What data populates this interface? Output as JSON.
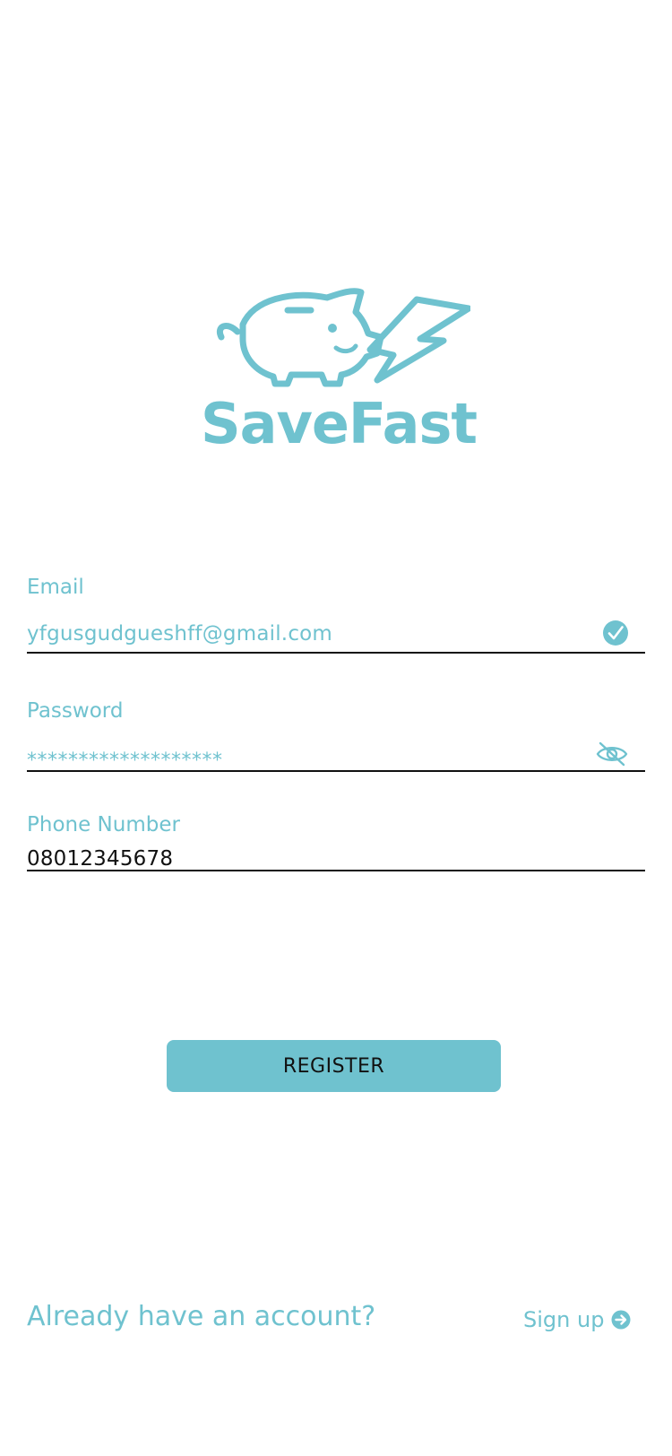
{
  "brand": {
    "name": "SaveFast",
    "logo_icon": "piggy-bank-lightning-icon",
    "color": "#6fc2cf"
  },
  "form": {
    "email": {
      "label": "Email",
      "value": "yfgusgudgueshff@gmail.com",
      "status_icon": "check-circle-icon"
    },
    "password": {
      "label": "Password",
      "value": "*******************",
      "toggle_icon": "eye-off-icon"
    },
    "phone": {
      "label": "Phone Number",
      "value": "08012345678"
    }
  },
  "actions": {
    "register_label": "REGISTER"
  },
  "footer": {
    "question": "Already have an account?",
    "signup_label": "Sign up",
    "signup_icon": "arrow-right-circle-icon"
  }
}
